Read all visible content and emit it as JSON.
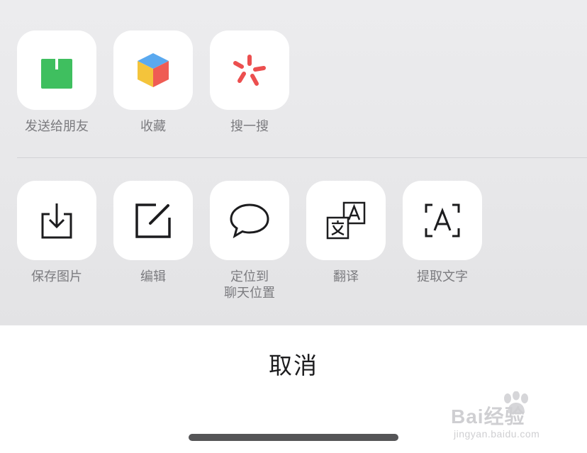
{
  "share_sheet": {
    "primary_actions": [
      {
        "label": "发送给朋友",
        "icon": "share-upload-icon",
        "color": "#3fbf5f"
      },
      {
        "label": "收藏",
        "icon": "favorites-cube-icon",
        "colors": [
          "#5aa9ef",
          "#f4c43b",
          "#ef5c54"
        ]
      },
      {
        "label": "搜一搜",
        "icon": "search-sparkle-icon",
        "color": "#ec4f4f"
      }
    ],
    "secondary_actions": [
      {
        "label": "保存图片",
        "icon": "save-image-icon"
      },
      {
        "label": "编辑",
        "icon": "edit-icon"
      },
      {
        "label": "定位到\n聊天位置",
        "icon": "chat-bubble-icon"
      },
      {
        "label": "翻译",
        "icon": "translate-icon"
      },
      {
        "label": "提取文字",
        "icon": "text-extract-icon"
      }
    ]
  },
  "cancel": {
    "label": "取消"
  },
  "watermark": {
    "brand": "Bai经验",
    "sub": "jingyan.baidu.com"
  }
}
